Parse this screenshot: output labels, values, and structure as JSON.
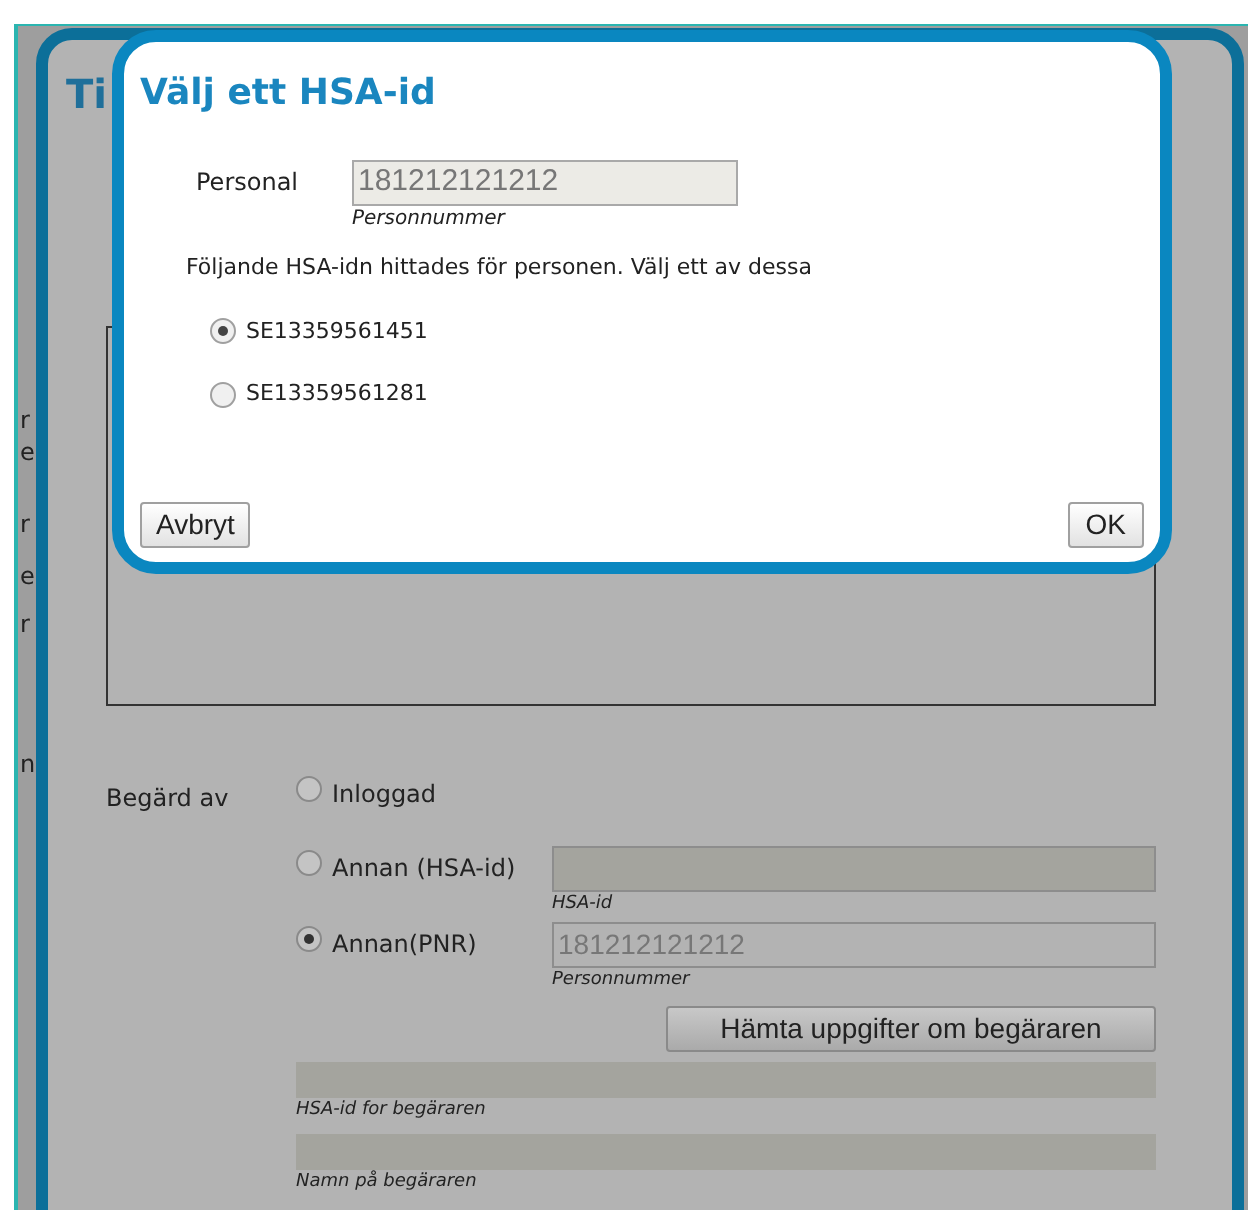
{
  "background_page": {
    "fragments": [
      "r",
      "e",
      "r",
      "e",
      "r",
      "n"
    ]
  },
  "underlying_dialog": {
    "title": "Ti",
    "requested_by": {
      "label": "Begärd av",
      "options": [
        {
          "label": "Inloggad",
          "selected": false
        },
        {
          "label": "Annan (HSA-id)",
          "selected": false,
          "field": {
            "hint": "HSA-id"
          }
        },
        {
          "label": "Annan(PNR)",
          "selected": true,
          "field": {
            "value": "181212121212",
            "hint": "Personnummer"
          }
        }
      ]
    },
    "fetch_button": "Hämta uppgifter om begäraren",
    "fields": [
      {
        "caption": "HSA-id for begäraren"
      },
      {
        "caption": "Namn på begäraren"
      }
    ]
  },
  "dialog": {
    "title": "Välj ett HSA-id",
    "person_label": "Personal",
    "person_value": "181212121212",
    "person_hint": "Personnummer",
    "instruction": "Följande HSA-idn hittades för personen. Välj ett av dessa",
    "options": [
      {
        "label": "SE13359561451",
        "selected": true
      },
      {
        "label": "SE13359561281",
        "selected": false
      }
    ],
    "cancel_button": "Avbryt",
    "ok_button": "OK"
  }
}
